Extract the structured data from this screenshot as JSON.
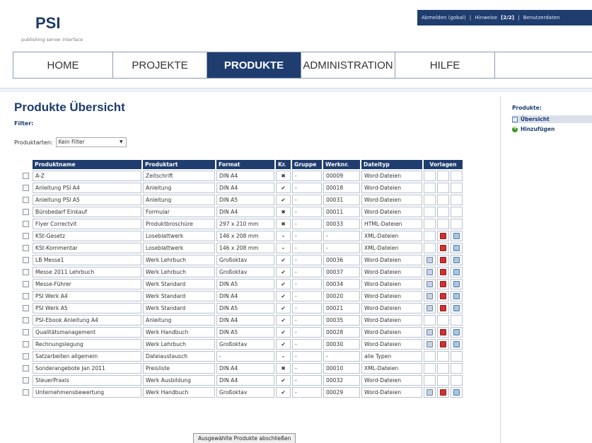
{
  "header": {
    "logo": "PSI",
    "logo_sub": "publishing server interface",
    "topbar": {
      "logout": "Abmelden (gobal)",
      "separator": "|",
      "hints": "Hinweise",
      "hints_count": "[2/2]",
      "user": "Benutzerdaten"
    }
  },
  "nav": {
    "items": [
      {
        "label": "HOME"
      },
      {
        "label": "PROJEKTE"
      },
      {
        "label": "PRODUKTE"
      },
      {
        "label": "ADMINISTRATION"
      },
      {
        "label": "HILFE"
      }
    ],
    "active": "PRODUKTE"
  },
  "main": {
    "title": "Produkte Übersicht",
    "filter_heading": "Filter:",
    "filter_label": "Produktarten:",
    "filter_value": "Kein Filter",
    "submit_label": "Ausgewählte Produkte abschließen"
  },
  "table": {
    "headers": [
      "Produktname",
      "Produktart",
      "Format",
      "Kr.",
      "Gruppe",
      "Werknr.",
      "Dateityp",
      "Vorlagen"
    ],
    "rows": [
      {
        "name": "A-Z",
        "art": "Zeitschrift",
        "format": "DIN A4",
        "kr": "x",
        "gruppe": "-",
        "werknr": "00009",
        "dateityp": "Word-Dateien",
        "vorlagen": [
          false,
          false,
          false
        ]
      },
      {
        "name": "Anleitung PSI A4",
        "art": "Anleitung",
        "format": "DIN A4",
        "kr": "check",
        "gruppe": "-",
        "werknr": "00018",
        "dateityp": "Word-Dateien",
        "vorlagen": [
          false,
          false,
          false
        ]
      },
      {
        "name": "Anleitung PSI A5",
        "art": "Anleitung",
        "format": "DIN A5",
        "kr": "check",
        "gruppe": "-",
        "werknr": "00031",
        "dateityp": "Word-Dateien",
        "vorlagen": [
          false,
          false,
          false
        ]
      },
      {
        "name": "Bürobedarf Einkauf",
        "art": "Formular",
        "format": "DIN A4",
        "kr": "x",
        "gruppe": "-",
        "werknr": "00011",
        "dateityp": "Word-Dateien",
        "vorlagen": [
          false,
          false,
          false
        ]
      },
      {
        "name": "Flyer Correctvit",
        "art": "Produktbroschüre",
        "format": "297 x 210 mm",
        "kr": "x",
        "gruppe": "-",
        "werknr": "00033",
        "dateityp": "HTML-Dateien",
        "vorlagen": [
          false,
          false,
          false
        ]
      },
      {
        "name": "KSt-Gesetz",
        "art": "Loseblattwerk",
        "format": "146 x 208 mm",
        "kr": "-",
        "gruppe": "-",
        "werknr": "-",
        "dateityp": "XML-Dateien",
        "vorlagen": [
          false,
          true,
          true
        ]
      },
      {
        "name": "KSt-Kommentar",
        "art": "Loseblattwerk",
        "format": "146 x 208 mm",
        "kr": "-",
        "gruppe": "-",
        "werknr": "-",
        "dateityp": "XML-Dateien",
        "vorlagen": [
          false,
          true,
          true
        ]
      },
      {
        "name": "LB Messe1",
        "art": "Werk Lehrbuch",
        "format": "Großoktav",
        "kr": "check",
        "gruppe": "-",
        "werknr": "00036",
        "dateityp": "Word-Dateien",
        "vorlagen": [
          true,
          true,
          true
        ]
      },
      {
        "name": "Messe 2011 Lehrbuch",
        "art": "Werk Lehrbuch",
        "format": "Großoktav",
        "kr": "check",
        "gruppe": "-",
        "werknr": "00037",
        "dateityp": "Word-Dateien",
        "vorlagen": [
          true,
          true,
          true
        ]
      },
      {
        "name": "Messe-Führer",
        "art": "Werk Standard",
        "format": "DIN A5",
        "kr": "check",
        "gruppe": "-",
        "werknr": "00034",
        "dateityp": "Word-Dateien",
        "vorlagen": [
          true,
          true,
          true
        ]
      },
      {
        "name": "PSI Werk A4",
        "art": "Werk Standard",
        "format": "DIN A4",
        "kr": "check",
        "gruppe": "-",
        "werknr": "00020",
        "dateityp": "Word-Dateien",
        "vorlagen": [
          true,
          true,
          true
        ]
      },
      {
        "name": "PSI Werk A5",
        "art": "Werk Standard",
        "format": "DIN A5",
        "kr": "check",
        "gruppe": "-",
        "werknr": "00021",
        "dateityp": "Word-Dateien",
        "vorlagen": [
          true,
          true,
          true
        ]
      },
      {
        "name": "PSI-Ebook Anleitung A4",
        "art": "Anleitung",
        "format": "DIN A4",
        "kr": "check",
        "gruppe": "-",
        "werknr": "00035",
        "dateityp": "Word-Dateien",
        "vorlagen": [
          false,
          false,
          false
        ]
      },
      {
        "name": "Qualitätsmanagement",
        "art": "Werk Handbuch",
        "format": "DIN A5",
        "kr": "check",
        "gruppe": "-",
        "werknr": "00028",
        "dateityp": "Word-Dateien",
        "vorlagen": [
          true,
          true,
          true
        ]
      },
      {
        "name": "Rechnungslegung",
        "art": "Werk Lehrbuch",
        "format": "Großoktav",
        "kr": "check",
        "gruppe": "-",
        "werknr": "00030",
        "dateityp": "Word-Dateien",
        "vorlagen": [
          true,
          true,
          true
        ]
      },
      {
        "name": "Satzarbeiten allgemein",
        "art": "Dateiaustausch",
        "format": "-",
        "kr": "-",
        "gruppe": "-",
        "werknr": "-",
        "dateityp": "alle Typen",
        "vorlagen": [
          false,
          false,
          false
        ]
      },
      {
        "name": "Sonderangebote Jan 2011",
        "art": "Preisliste",
        "format": "DIN A4",
        "kr": "x",
        "gruppe": "-",
        "werknr": "00010",
        "dateityp": "XML-Dateien",
        "vorlagen": [
          false,
          false,
          false
        ]
      },
      {
        "name": "SteuerPraxis",
        "art": "Werk Ausbildung",
        "format": "DIN A4",
        "kr": "check",
        "gruppe": "-",
        "werknr": "00032",
        "dateityp": "Word-Dateien",
        "vorlagen": [
          false,
          false,
          false
        ]
      },
      {
        "name": "Unternehmensbewertung",
        "art": "Werk Handbuch",
        "format": "Großoktav",
        "kr": "check",
        "gruppe": "-",
        "werknr": "00029",
        "dateityp": "Word-Dateien",
        "vorlagen": [
          true,
          true,
          true
        ]
      }
    ]
  },
  "sidebar": {
    "title": "Produkte:",
    "items": [
      {
        "label": "Übersicht",
        "icon": "list-icon"
      },
      {
        "label": "Hinzufügen",
        "icon": "add-icon"
      }
    ]
  },
  "colors": {
    "brand": "#1f3d6e",
    "check": "#3a9a2a",
    "cross": "#c41d1d"
  }
}
